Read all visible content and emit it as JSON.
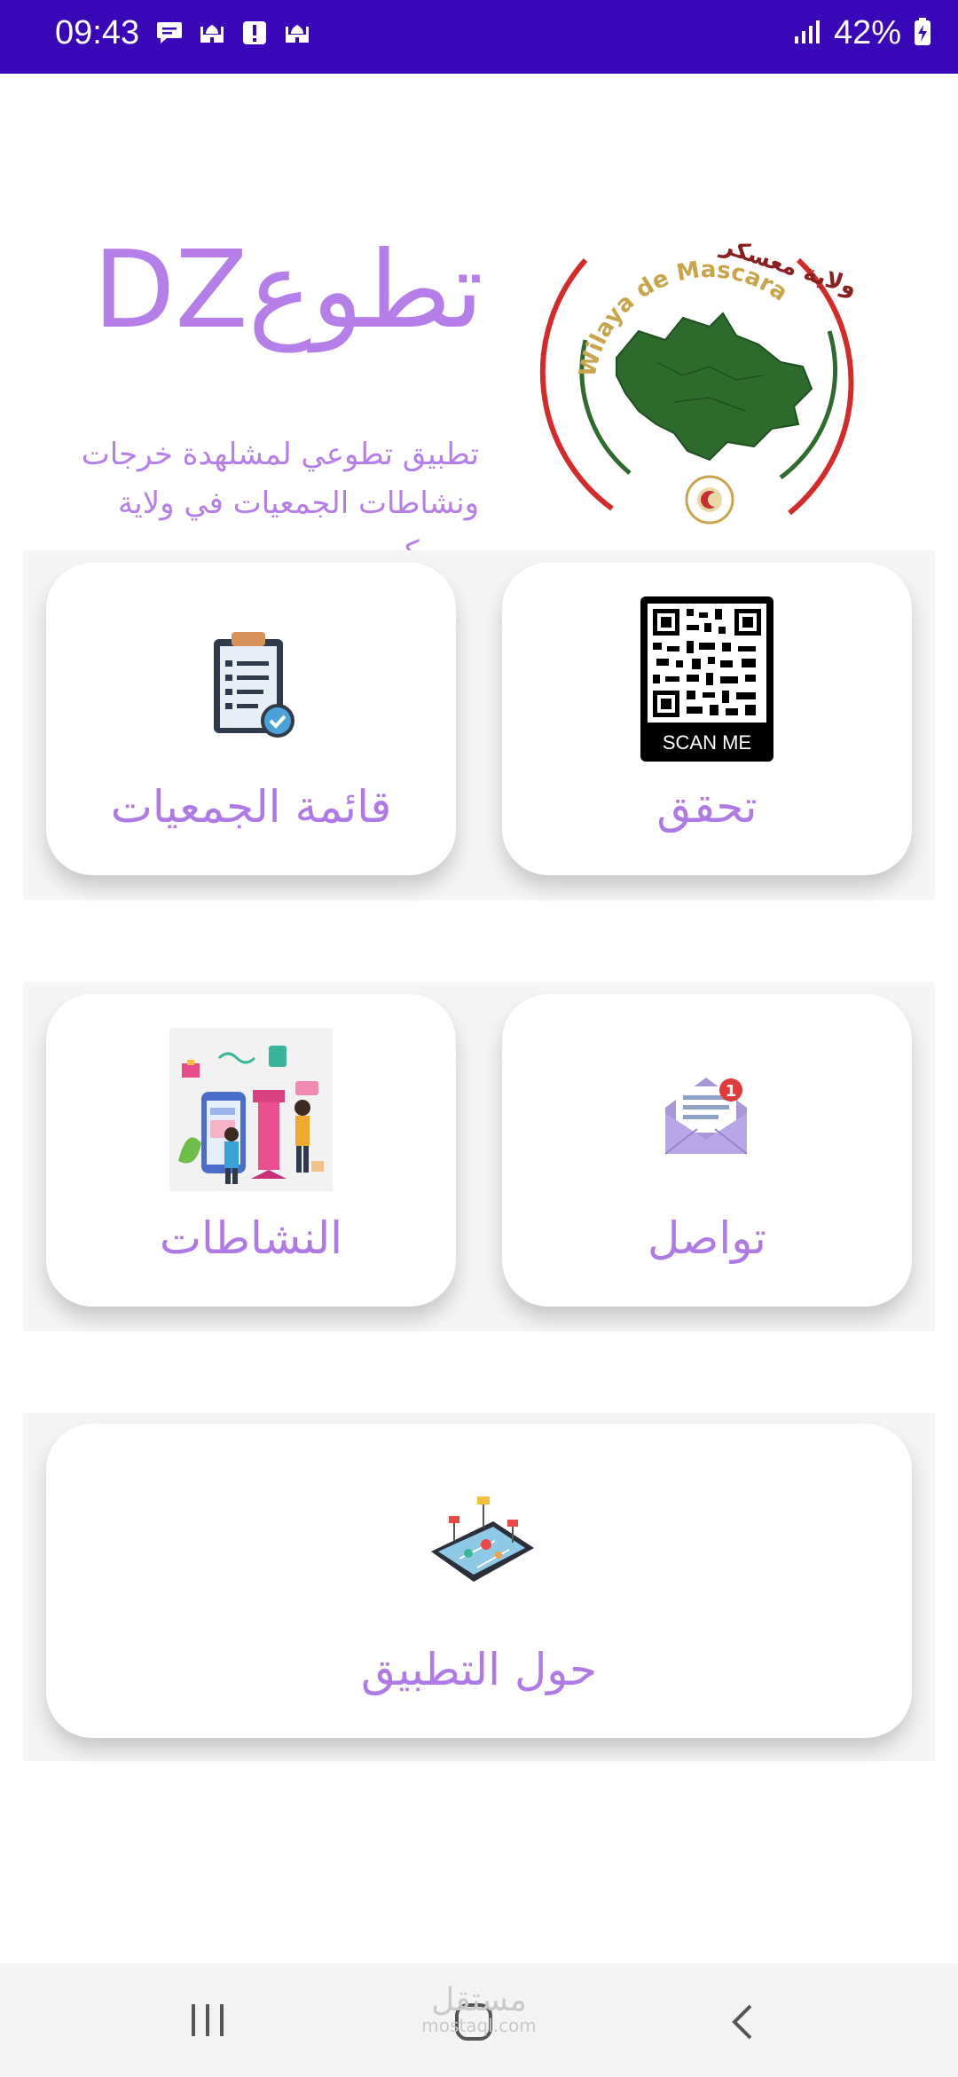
{
  "status_bar": {
    "time": "09:43",
    "battery": "42%",
    "icons_left": [
      "chat-bubble-icon",
      "mosque-icon",
      "alert-icon",
      "mosque-icon"
    ],
    "icons_right": [
      "signal-icon",
      "battery-charging-icon"
    ]
  },
  "header": {
    "title_ar": "تطوع",
    "title_dz": "DZ",
    "subtitle": "تطبيق تطوعي لمشلهدة خرجات ونشاطات الجمعيات في ولاية معسكر",
    "logo": {
      "arc_text_ar": "ولاية معسكر",
      "arc_text_fr": "Wilaya de Mascara"
    }
  },
  "cards": {
    "associations": {
      "label": "قائمة الجمعيات",
      "icon": "clipboard-checklist-icon"
    },
    "verify": {
      "label": "تحقق",
      "icon": "qr-code-icon",
      "qr_caption": "SCAN ME"
    },
    "activities": {
      "label": "النشاطات",
      "icon": "activities-illustration-icon"
    },
    "contact": {
      "label": "تواصل",
      "icon": "mail-envelope-icon",
      "badge": "1"
    },
    "about": {
      "label": "حول التطبيق",
      "icon": "tablet-map-illustration-icon"
    }
  },
  "nav_bar": {
    "items": [
      "recent-apps-icon",
      "home-icon",
      "back-icon"
    ],
    "watermark": "مستقل",
    "watermark_sub": "mostaql.com"
  },
  "colors": {
    "status_bar": "#3a07b8",
    "accent": "#b57ee8",
    "section_bg": "#f5f5f5",
    "card_bg": "#ffffff"
  }
}
